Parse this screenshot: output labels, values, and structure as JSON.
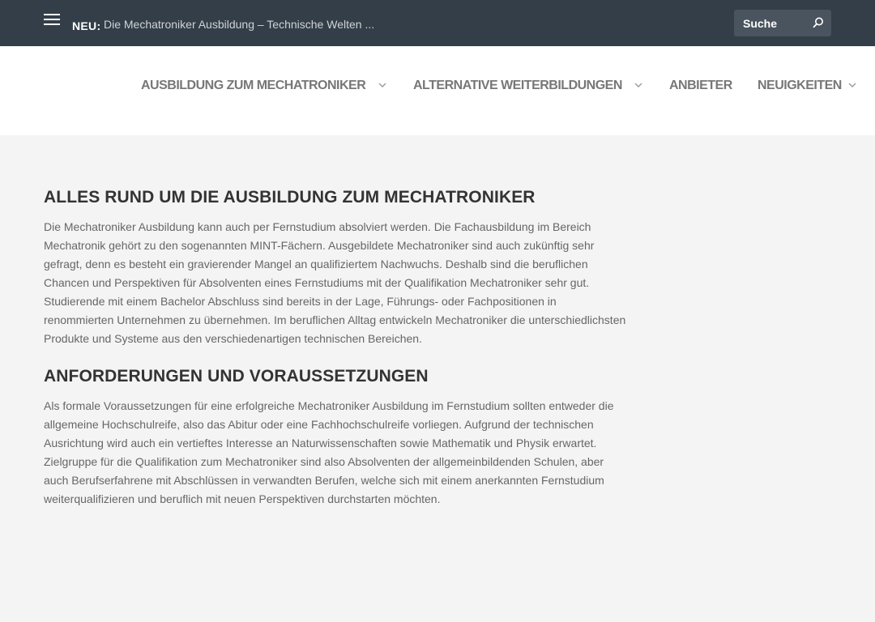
{
  "topbar": {
    "news_label": "NEU:",
    "news_text": "Die Mechatroniker Ausbildung – Technische Welten ...",
    "search_placeholder": "Suche"
  },
  "nav": {
    "items": [
      {
        "label": "AUSBILDUNG ZUM MECHATRONIKER",
        "has_dropdown": true
      },
      {
        "label": "ALTERNATIVE WEITERBILDUNGEN",
        "has_dropdown": true
      },
      {
        "label": "ANBIETER",
        "has_dropdown": false
      },
      {
        "label": "NEUIGKEITEN",
        "has_dropdown": true
      }
    ]
  },
  "main": {
    "sections": [
      {
        "heading": "ALLES RUND UM DIE AUSBILDUNG ZUM MECHATRONIKER",
        "text": "Die Mechatroniker Ausbildung kann auch per Fernstudium absolviert werden. Die Fachausbildung im Bereich Mechatronik gehört zu den sogenannten MINT-Fächern. Ausgebildete Mechatroniker sind auch zukünftig sehr gefragt, denn es besteht ein gravierender Mangel an qualifiziertem Nachwuchs. Deshalb sind die beruflichen Chancen und Perspektiven für Absolventen eines Fernstudiums mit der Qualifikation Mechatroniker sehr gut. Studierende mit einem Bachelor Abschluss sind bereits in der Lage, Führungs- oder Fachpositionen in renommierten Unternehmen zu übernehmen. Im beruflichen Alltag entwickeln Mechatroniker die unterschiedlichsten Produkte und Systeme aus den verschiedenartigen technischen Bereichen."
      },
      {
        "heading": "ANFORDERUNGEN UND VORAUSSETZUNGEN",
        "text": "Als formale Voraussetzungen für eine erfolgreiche Mechatroniker Ausbildung im Fernstudium sollten entweder die allgemeine Hochschulreife, also das Abitur oder eine Fachhochschulreife vorliegen. Aufgrund der technischen Ausrichtung wird auch ein vertieftes Interesse an Naturwissenschaften sowie Mathematik und Physik erwartet. Zielgruppe für die Qualifikation zum Mechatroniker sind also Absolventen der allgemeinbildenden Schulen, aber auch Berufserfahrene mit Abschlüssen in verwandten Berufen, welche sich mit einem anerkannten Fernstudium weiterqualifizieren und beruflich mit neuen Perspektiven durchstarten möchten."
      }
    ]
  },
  "colors": {
    "topbar_bg": "#333e48",
    "page_bg": "#f4f4f4",
    "heading": "#333333",
    "body_text": "#666666",
    "nav_text": "#777777"
  },
  "icons": {
    "menu": "hamburger-menu-icon",
    "search": "search-icon",
    "dropdown": "chevron-down-icon"
  }
}
